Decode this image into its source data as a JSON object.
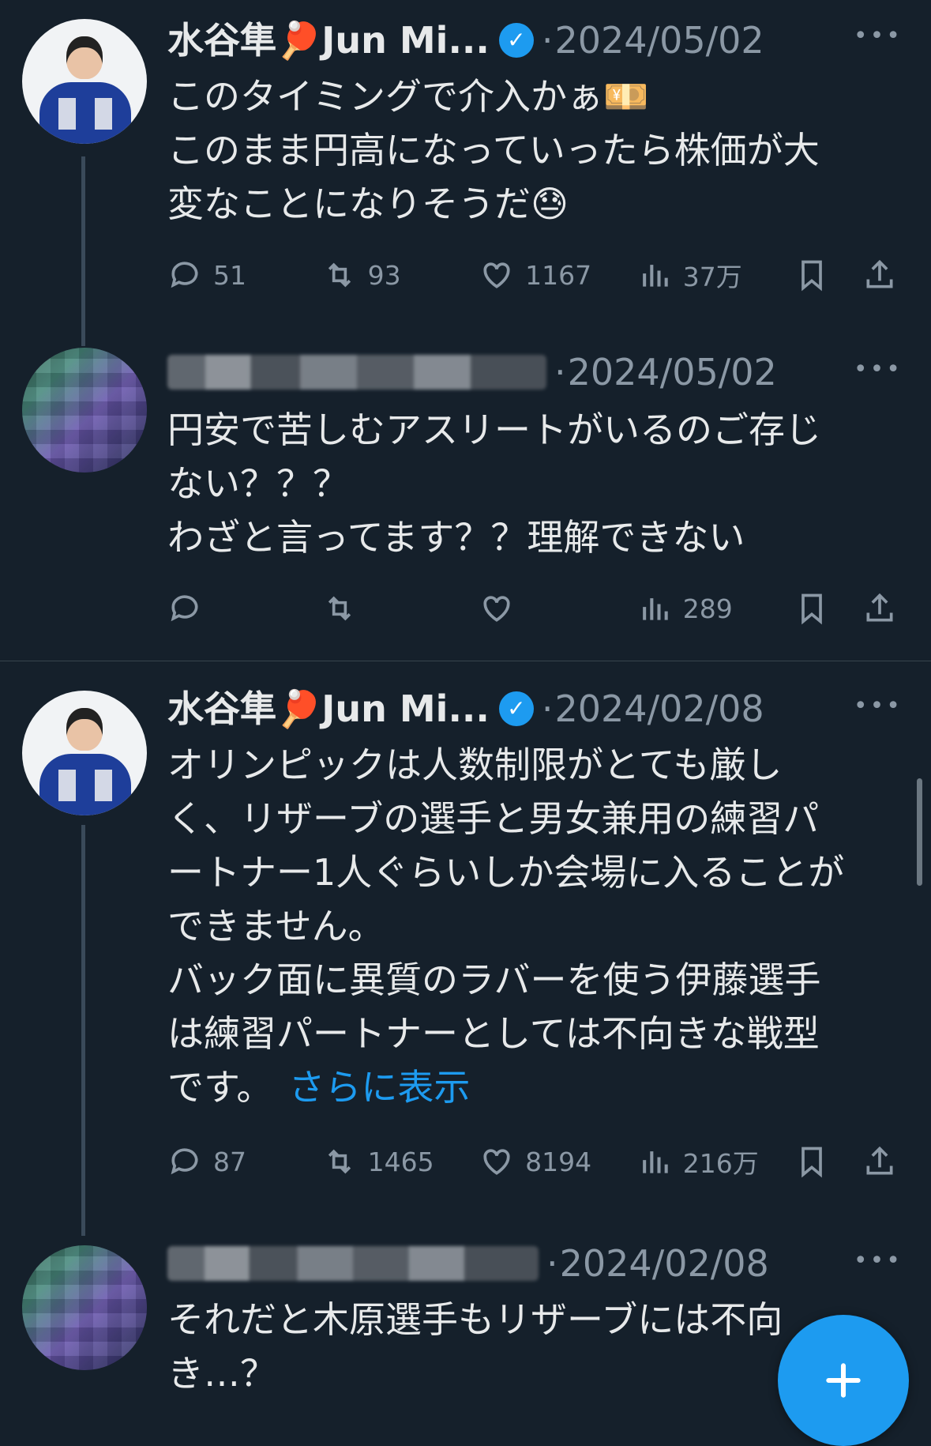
{
  "tweets": [
    {
      "name": "水谷隼🏓Jun Mi...",
      "verified": true,
      "date": "2024/05/02",
      "text": "このタイミングで介入かぁ💴\nこのまま円高になっていったら株価が大\n変なことになりそうだ😓",
      "replies": "51",
      "retweets": "93",
      "likes": "1167",
      "views": "37万"
    },
    {
      "date": "2024/05/02",
      "text": "円安で苦しむアスリートがいるのご存じ\nない？？？\nわざと言ってます？？理解できない",
      "views": "289"
    },
    {
      "name": "水谷隼🏓Jun Mi...",
      "verified": true,
      "date": "2024/02/08",
      "text": "オリンピックは人数制限がとても厳し\nく、リザーブの選手と男女兼用の練習パ\nートナー1人ぐらいしか会場に入ることが\nできません。\nバック面に異質のラバーを使う伊藤選手\nは練習パートナーとしては不向きな戦型\nです。",
      "show_more": "さらに表示",
      "replies": "87",
      "retweets": "1465",
      "likes": "8194",
      "views": "216万"
    },
    {
      "date": "2024/02/08",
      "text": "それだと木原選手もリザーブには不向\nき…？"
    }
  ],
  "separator": "·",
  "more_label": "•••",
  "fab_label": "+",
  "colors": {
    "accent": "#1d9bf0",
    "background": "#15202b",
    "muted": "#8b98a5"
  },
  "icons": [
    "reply-icon",
    "retweet-icon",
    "like-icon",
    "views-icon",
    "bookmark-icon",
    "share-icon",
    "verified-icon",
    "more-icon",
    "compose-icon"
  ]
}
